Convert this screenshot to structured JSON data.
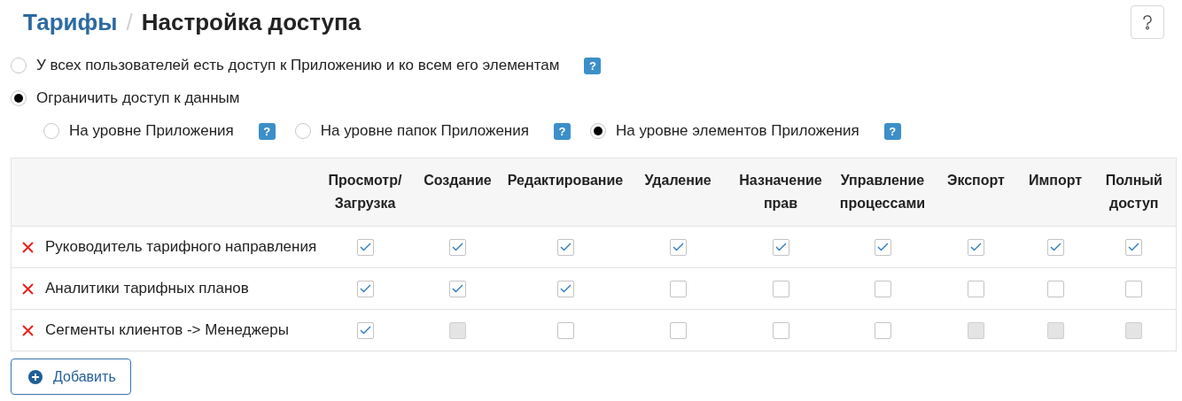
{
  "breadcrumb": {
    "parent": "Тарифы",
    "separator": "/",
    "current": "Настройка доступа"
  },
  "access_options": [
    {
      "label": "У всех пользователей есть доступ к Приложению и ко всем его элементам",
      "selected": false,
      "help": "?"
    },
    {
      "label": "Ограничить доступ к данным",
      "selected": true
    }
  ],
  "restriction_levels": [
    {
      "label": "На уровне Приложения",
      "selected": false,
      "help": "?"
    },
    {
      "label": "На уровне папок Приложения",
      "selected": false,
      "help": "?"
    },
    {
      "label": "На уровне элементов Приложения",
      "selected": true,
      "help": "?"
    }
  ],
  "table": {
    "columns": [
      "Просмотр/\nЗагрузка",
      "Создание",
      "Редактирование",
      "Удаление",
      "Назначение\nправ",
      "Управление\nпроцессами",
      "Экспорт",
      "Импорт",
      "Полный\nдоступ"
    ],
    "rows": [
      {
        "name": "Руководитель тарифного направления",
        "cells": [
          {
            "checked": true,
            "disabled": false
          },
          {
            "checked": true,
            "disabled": false
          },
          {
            "checked": true,
            "disabled": false
          },
          {
            "checked": true,
            "disabled": false
          },
          {
            "checked": true,
            "disabled": false
          },
          {
            "checked": true,
            "disabled": false
          },
          {
            "checked": true,
            "disabled": false
          },
          {
            "checked": true,
            "disabled": false
          },
          {
            "checked": true,
            "disabled": false
          }
        ]
      },
      {
        "name": "Аналитики тарифных планов",
        "cells": [
          {
            "checked": true,
            "disabled": false
          },
          {
            "checked": true,
            "disabled": false
          },
          {
            "checked": true,
            "disabled": false
          },
          {
            "checked": false,
            "disabled": false
          },
          {
            "checked": false,
            "disabled": false
          },
          {
            "checked": false,
            "disabled": false
          },
          {
            "checked": false,
            "disabled": false
          },
          {
            "checked": false,
            "disabled": false
          },
          {
            "checked": false,
            "disabled": false
          }
        ]
      },
      {
        "name": "Сегменты клиентов -> Менеджеры",
        "cells": [
          {
            "checked": true,
            "disabled": false
          },
          {
            "checked": false,
            "disabled": true
          },
          {
            "checked": false,
            "disabled": false
          },
          {
            "checked": false,
            "disabled": false
          },
          {
            "checked": false,
            "disabled": false
          },
          {
            "checked": false,
            "disabled": false
          },
          {
            "checked": false,
            "disabled": true
          },
          {
            "checked": false,
            "disabled": true
          },
          {
            "checked": false,
            "disabled": true
          }
        ]
      }
    ]
  },
  "add_button": {
    "label": "Добавить"
  }
}
